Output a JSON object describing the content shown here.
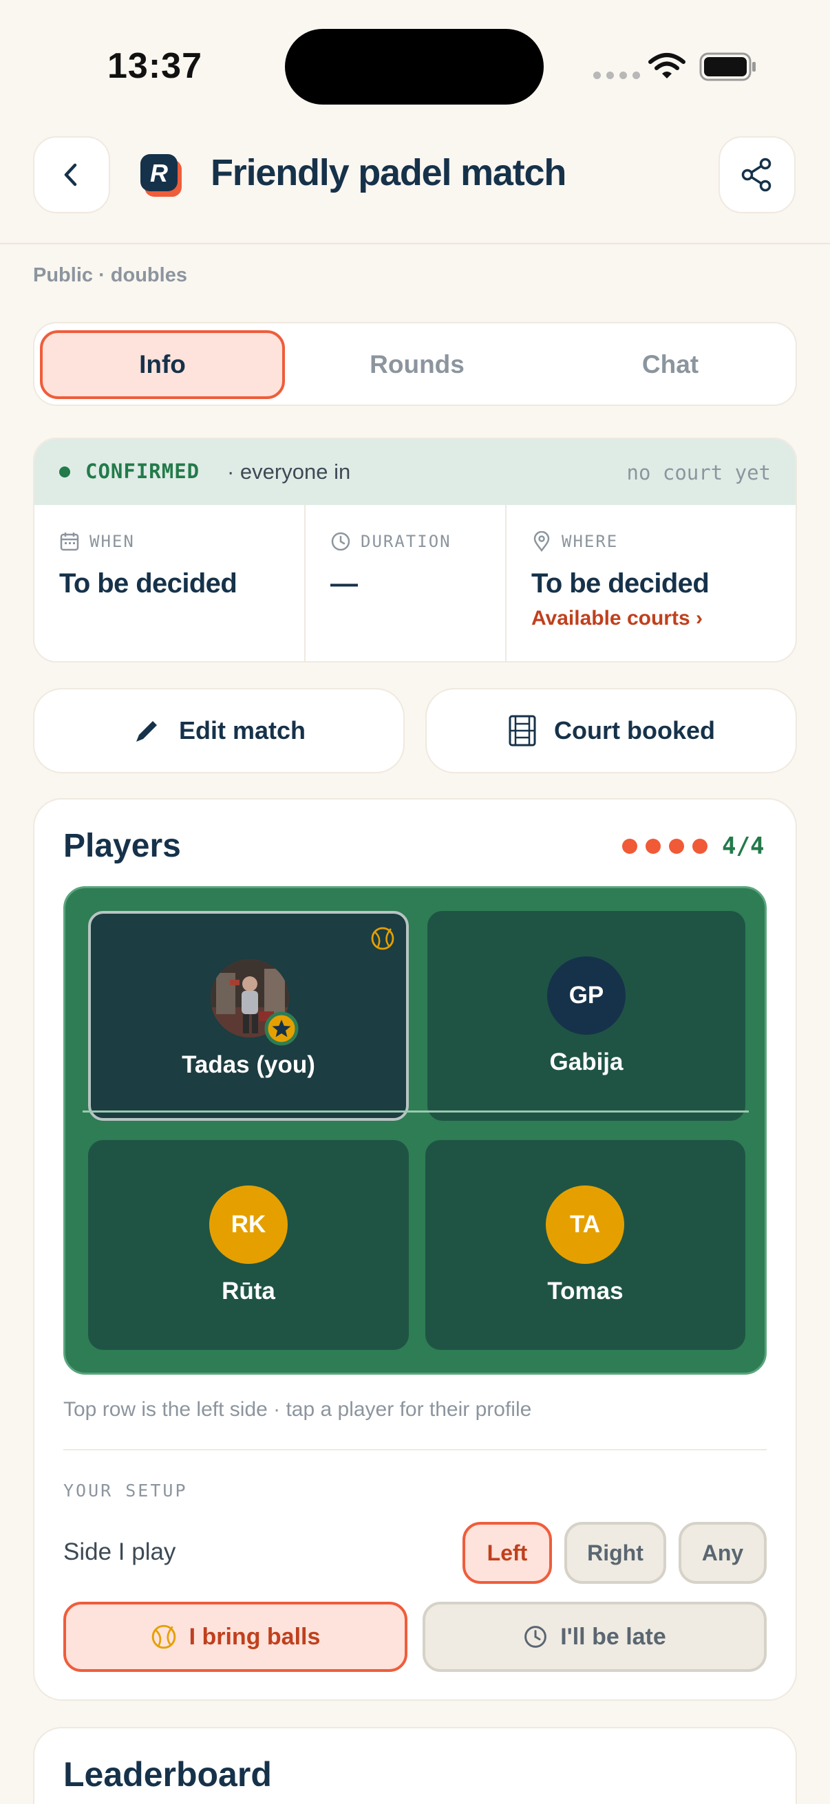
{
  "status_bar": {
    "time": "13:37"
  },
  "header": {
    "title": "Friendly padel match",
    "app_logo_letter": "R",
    "subtitle": "Public · doubles"
  },
  "tabs": [
    {
      "label": "Info",
      "active": true
    },
    {
      "label": "Rounds",
      "active": false
    },
    {
      "label": "Chat",
      "active": false
    }
  ],
  "status": {
    "state": "CONFIRMED",
    "detail": "· everyone in",
    "court_note": "no court yet",
    "state_color": "#237a4a"
  },
  "info": {
    "when_label": "WHEN",
    "when_value": "To be decided",
    "duration_label": "DURATION",
    "duration_value": "—",
    "where_label": "WHERE",
    "where_value": "To be decided",
    "where_link": "Available courts ›"
  },
  "actions": {
    "edit_label": "Edit match",
    "court_label": "Court booked"
  },
  "players": {
    "title": "Players",
    "count": "4/4",
    "slots_filled": 4,
    "list": [
      {
        "name": "Tadas (you)",
        "initials": "",
        "avatar_color": "#6b5a4e",
        "is_you": true,
        "brings_balls": true,
        "is_host": true
      },
      {
        "name": "Gabija",
        "initials": "GP",
        "avatar_color": "#16324a"
      },
      {
        "name": "Rūta",
        "initials": "RK",
        "avatar_color": "#e5a000"
      },
      {
        "name": "Tomas",
        "initials": "TA",
        "avatar_color": "#e5a000"
      }
    ],
    "caption": "Top row is the left side · tap a player for their profile"
  },
  "setup": {
    "label": "YOUR SETUP",
    "side_label": "Side I play",
    "sides": [
      {
        "label": "Left",
        "active": true
      },
      {
        "label": "Right",
        "active": false
      },
      {
        "label": "Any",
        "active": false
      }
    ],
    "balls_label": "I bring balls",
    "balls_on": true,
    "late_label": "I'll be late",
    "late_on": false
  },
  "leaderboard": {
    "title": "Leaderboard"
  },
  "colors": {
    "accent": "#ef5d3b",
    "navy": "#16324a",
    "green": "#237a4a",
    "court": "#2e7d54"
  }
}
